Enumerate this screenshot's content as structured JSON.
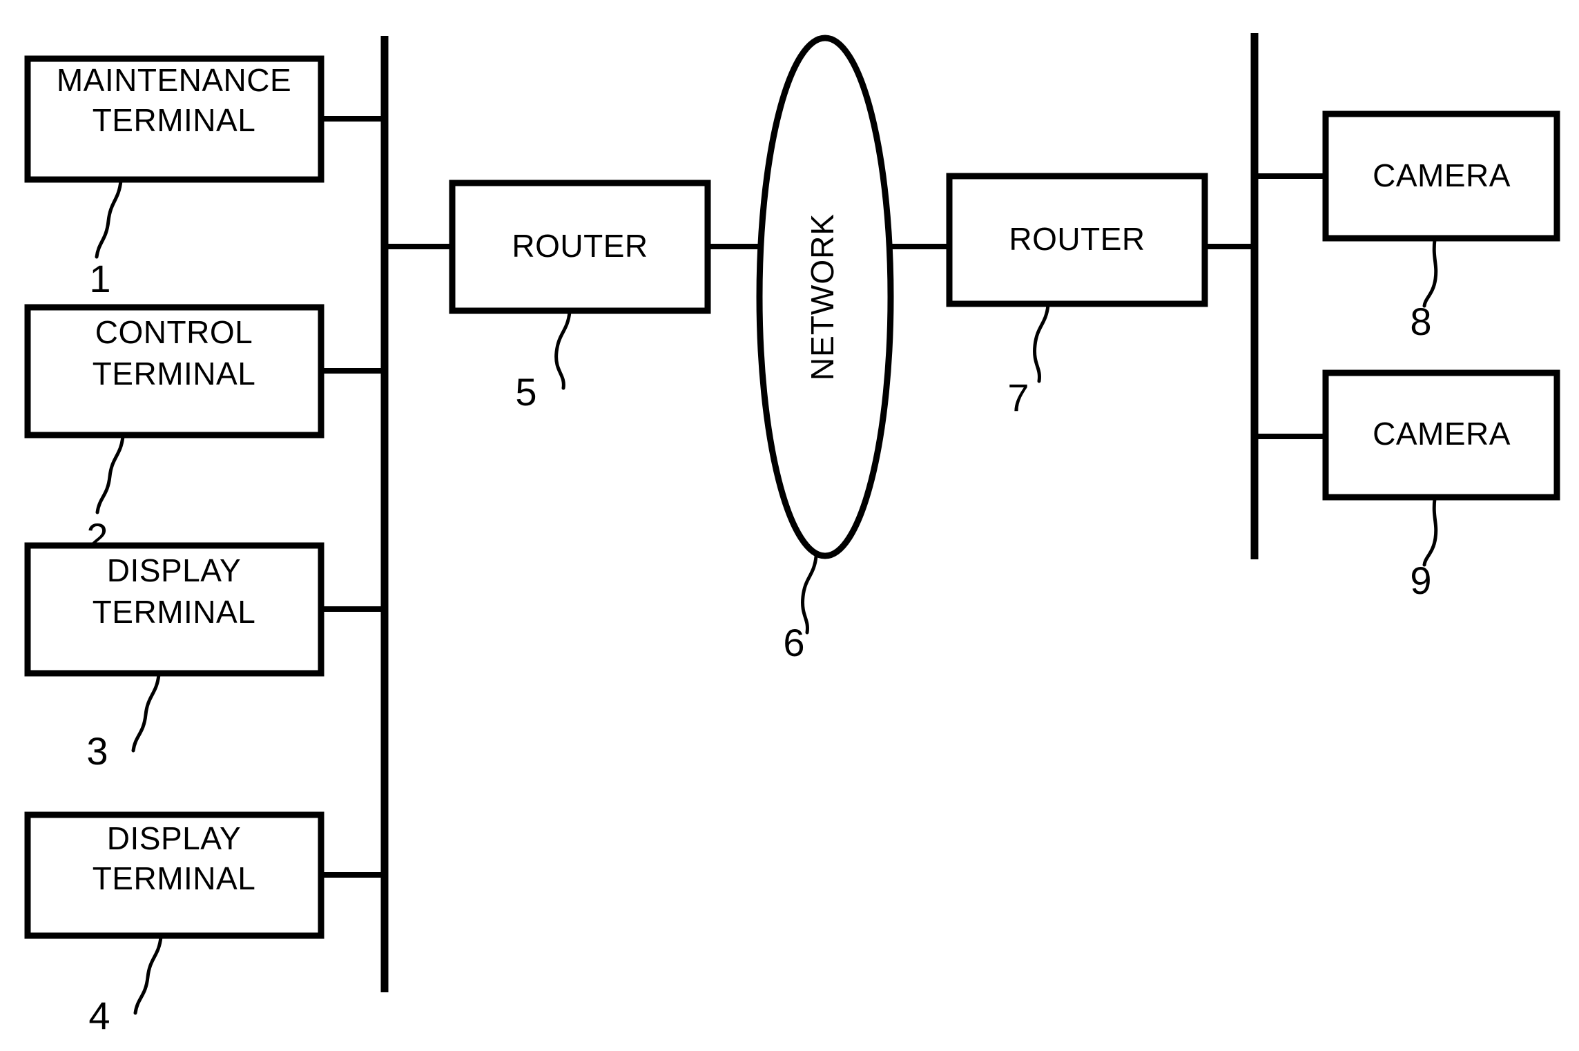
{
  "figure": {
    "type": "patent-block-diagram",
    "background_color": "#ffffff",
    "line_color": "#000000"
  },
  "nodes": {
    "maintenance_terminal": {
      "label_line1": "MAINTENANCE",
      "label_line2": "TERMINAL",
      "ref": "1"
    },
    "control_terminal": {
      "label_line1": "CONTROL",
      "label_line2": "TERMINAL",
      "ref": "2"
    },
    "display_terminal_a": {
      "label_line1": "DISPLAY",
      "label_line2": "TERMINAL",
      "ref": "3"
    },
    "display_terminal_b": {
      "label_line1": "DISPLAY",
      "label_line2": "TERMINAL",
      "ref": "4"
    },
    "router_left": {
      "label": "ROUTER",
      "ref": "5"
    },
    "network": {
      "label": "NETWORK",
      "ref": "6"
    },
    "router_right": {
      "label": "ROUTER",
      "ref": "7"
    },
    "camera_top": {
      "label": "CAMERA",
      "ref": "8"
    },
    "camera_bottom": {
      "label": "CAMERA",
      "ref": "9"
    }
  }
}
